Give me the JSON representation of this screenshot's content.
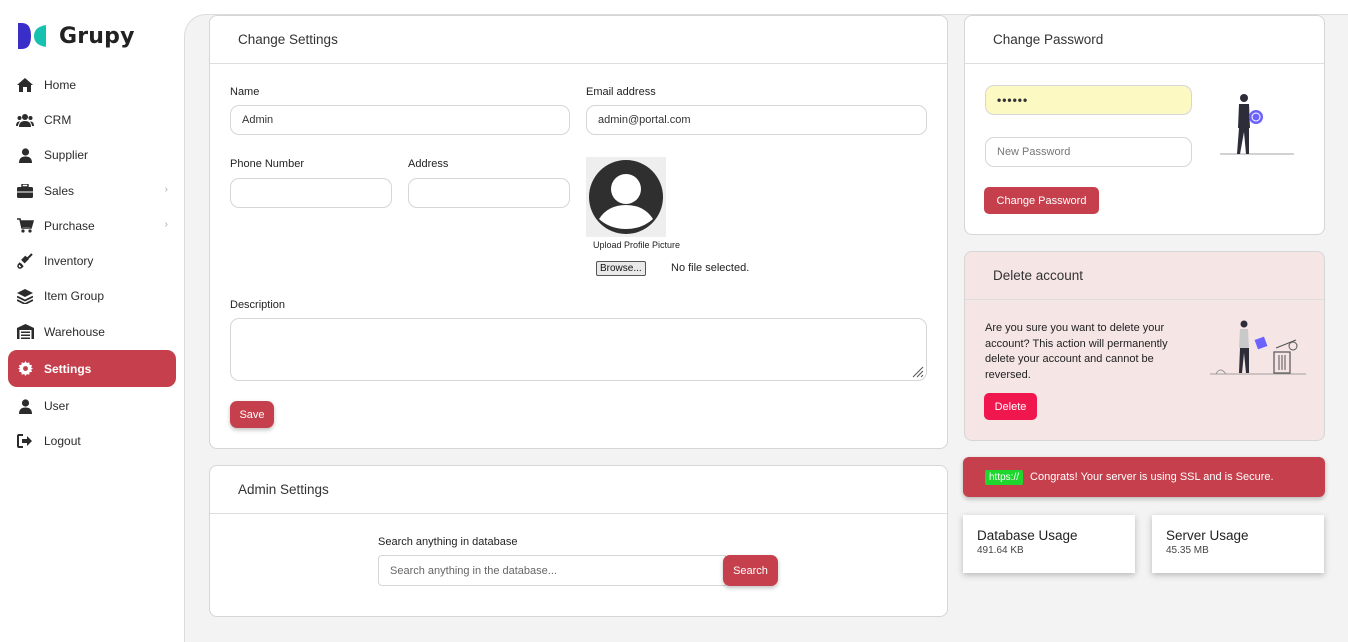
{
  "app": {
    "name": "Grupy"
  },
  "sidebar": {
    "items": [
      {
        "label": "Home",
        "icon": "home-icon",
        "active": false,
        "chevron": false
      },
      {
        "label": "CRM",
        "icon": "users-icon",
        "active": false,
        "chevron": false
      },
      {
        "label": "Supplier",
        "icon": "user-icon",
        "active": false,
        "chevron": false
      },
      {
        "label": "Sales",
        "icon": "briefcase-icon",
        "active": false,
        "chevron": true
      },
      {
        "label": "Purchase",
        "icon": "cart-icon",
        "active": false,
        "chevron": true
      },
      {
        "label": "Inventory",
        "icon": "dolly-icon",
        "active": false,
        "chevron": false
      },
      {
        "label": "Item Group",
        "icon": "layers-icon",
        "active": false,
        "chevron": false
      },
      {
        "label": "Warehouse",
        "icon": "warehouse-icon",
        "active": false,
        "chevron": false
      },
      {
        "label": "Settings",
        "icon": "gear-icon",
        "active": true,
        "chevron": false
      },
      {
        "label": "User",
        "icon": "user-icon",
        "active": false,
        "chevron": false
      },
      {
        "label": "Logout",
        "icon": "logout-icon",
        "active": false,
        "chevron": false
      }
    ]
  },
  "change_settings": {
    "title": "Change Settings",
    "name_label": "Name",
    "name_value": "Admin",
    "email_label": "Email address",
    "email_value": "admin@portal.com",
    "phone_label": "Phone Number",
    "phone_value": "",
    "address_label": "Address",
    "address_value": "",
    "upload_label": "Upload Profile Picture",
    "browse_label": "Browse...",
    "file_status": "No file selected.",
    "description_label": "Description",
    "save_label": "Save"
  },
  "change_password": {
    "title": "Change Password",
    "current_value": "••••••",
    "new_placeholder": "New Password",
    "button_label": "Change Password"
  },
  "delete_account": {
    "title": "Delete account",
    "message": "Are you sure you want to delete your account? This action will permanently delete your account and cannot be reversed.",
    "button_label": "Delete"
  },
  "ssl": {
    "badge": "https://",
    "message": "Congrats! Your server is using SSL and is Secure."
  },
  "admin_settings": {
    "title": "Admin Settings",
    "search_label": "Search anything in database",
    "search_placeholder": "Search anything in the database...",
    "search_button": "Search"
  },
  "usage": {
    "database": {
      "title": "Database Usage",
      "value": "491.64 KB"
    },
    "server": {
      "title": "Server Usage",
      "value": "45.35 MB"
    }
  },
  "colors": {
    "accent": "#c5404c",
    "delete_button": "#f0174f",
    "ssl_badge": "#1fd62f",
    "password_fill": "#fdf9c3",
    "delete_card_bg": "#f5e5e5",
    "logo_blue": "#3a2ec9",
    "logo_teal": "#17c1b0"
  }
}
